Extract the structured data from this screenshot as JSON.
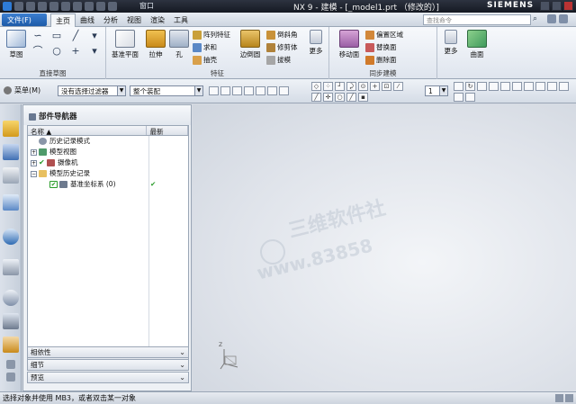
{
  "titlebar": {
    "window_menu": "窗口",
    "title": "NX 9 - 建模 - [_model1.prt （修改的）]",
    "brand": "SIEMENS"
  },
  "menubar": {
    "file_label": "文件(F)",
    "tabs": [
      {
        "label": "主页",
        "active": true
      },
      {
        "label": "曲线",
        "active": false
      },
      {
        "label": "分析",
        "active": false
      },
      {
        "label": "视图",
        "active": false
      },
      {
        "label": "渲染",
        "active": false
      },
      {
        "label": "工具",
        "active": false
      }
    ],
    "search_placeholder": "查找命令"
  },
  "ribbon": {
    "sketch_label": "草图",
    "direct_sketch_group": "直接草图",
    "feature_group": "特征",
    "sync_group": "同步建模",
    "datum_plane": "基准平面",
    "extrude": "拉伸",
    "hole": "孔",
    "pattern_feature": "阵列特征",
    "unite": "求和",
    "shell": "抽壳",
    "edge_blend": "边倒圆",
    "chamfer": "倒斜角",
    "trim_body": "修剪体",
    "draft": "拔模",
    "more1": "更多",
    "move_face": "移动面",
    "offset_region": "偏置区域",
    "replace_face": "替换面",
    "delete_face": "删除面",
    "more2": "更多",
    "surface": "曲面"
  },
  "toolbar2": {
    "menu_label": "菜单(M)",
    "filter_value": "没有选择过滤器",
    "scope_value": "整个装配"
  },
  "navigator": {
    "title": "部件导航器",
    "col_name": "名称",
    "col_newest": "最新",
    "rows": [
      {
        "label": "历史记录模式",
        "check": ""
      },
      {
        "label": "模型视图",
        "check": ""
      },
      {
        "label": "摄像机",
        "check": ""
      },
      {
        "label": "模型历史记录",
        "check": ""
      },
      {
        "label": "基准坐标系 (0)",
        "check": "✔"
      }
    ],
    "panels": [
      "相依性",
      "细节",
      "预览"
    ]
  },
  "graphics": {
    "watermark_line1": "三维软件社",
    "watermark_line2": "www.83858"
  },
  "status": {
    "text": "选择对象并使用 MB3，或者双击某一对象"
  },
  "colors": {
    "accent": "#1d5aa8",
    "check_green": "#2a9c2a"
  }
}
